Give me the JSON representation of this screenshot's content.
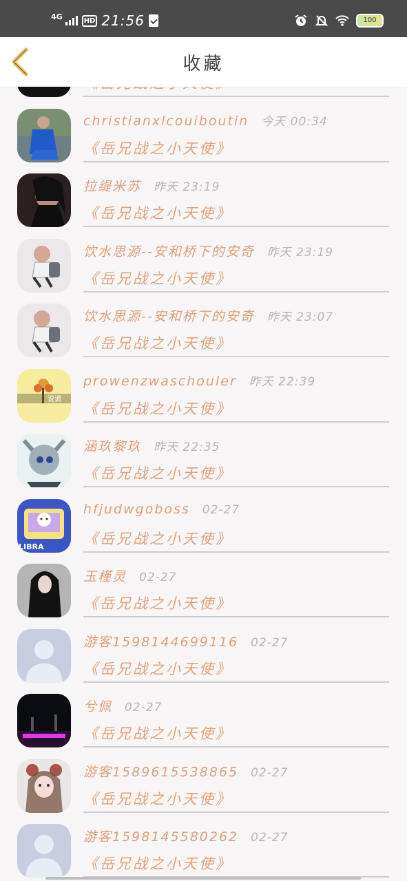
{
  "status_bar": {
    "network": "4G",
    "hd": "HD",
    "time": "21:56",
    "battery": "100",
    "icons": [
      "signal-icon",
      "clipboard-icon",
      "alarm-icon",
      "mute-bell-icon",
      "wifi-icon",
      "battery-icon"
    ]
  },
  "header": {
    "title": "收藏",
    "back_icon": "chevron-left-icon",
    "back_color": "#e7c76a"
  },
  "colors": {
    "name": "#e0a07a",
    "time": "#b9b6b6",
    "divider": "#cfcdcd"
  },
  "rows": [
    {
      "name": "",
      "time": "",
      "work": "《岳兄战之小天使》",
      "avatar": "dark-skull-avatar"
    },
    {
      "name": "christianxlcouiboutin",
      "time": "今天 00:34",
      "work": "《岳兄战之小天使》",
      "avatar": "boy-blue-jacket-avatar"
    },
    {
      "name": "拉缇米苏",
      "time": "昨天 23:19",
      "work": "《岳兄战之小天使》",
      "avatar": "dark-girl-avatar"
    },
    {
      "name": "饮水思源--安和桥下的安奇",
      "time": "昨天 23:19",
      "work": "《岳兄战之小天使》",
      "avatar": "anime-girl-backpack-avatar"
    },
    {
      "name": "饮水思源--安和桥下的安奇",
      "time": "昨天 23:07",
      "work": "《岳兄战之小天使》",
      "avatar": "anime-girl-backpack-avatar"
    },
    {
      "name": "prowenzwaschouler",
      "time": "昨天 22:39",
      "work": "《岳兄战之小天使》",
      "avatar": "flowers-yellow-avatar"
    },
    {
      "name": "涵玖黎玖",
      "time": "昨天 22:35",
      "work": "《岳兄战之小天使》",
      "avatar": "anime-cat-boy-avatar"
    },
    {
      "name": "hfjudwgoboss",
      "time": "02-27",
      "work": "《岳兄战之小天使》",
      "avatar": "libra-cartoon-avatar"
    },
    {
      "name": "玉槿灵",
      "time": "02-27",
      "work": "《岳兄战之小天使》",
      "avatar": "girl-black-hair-avatar"
    },
    {
      "name": "游客1598144699116",
      "time": "02-27",
      "work": "《岳兄战之小天使》",
      "avatar": "default-person-avatar"
    },
    {
      "name": "兮佩",
      "time": "02-27",
      "work": "《岳兄战之小天使》",
      "avatar": "night-neon-avatar"
    },
    {
      "name": "游客1589615538865",
      "time": "02-27",
      "work": "《岳兄战之小天使》",
      "avatar": "cat-ear-girl-avatar"
    },
    {
      "name": "游客1598145580262",
      "time": "02-27",
      "work": "《岳兄战之小天使》",
      "avatar": "default-person-avatar"
    }
  ]
}
